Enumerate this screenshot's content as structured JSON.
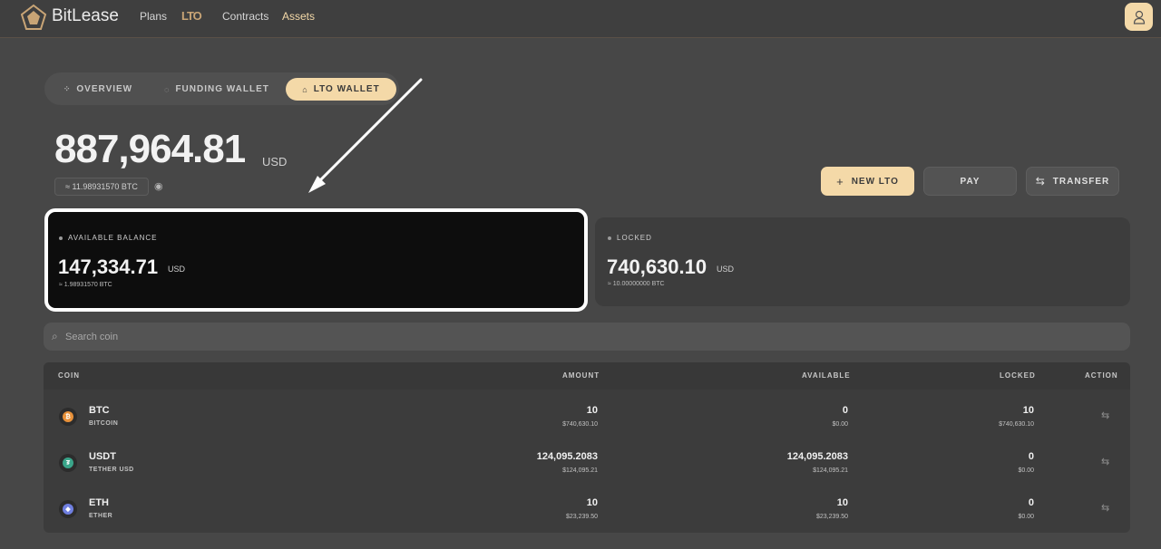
{
  "header": {
    "brand": "BitLease",
    "nav": {
      "plans": "Plans",
      "lto": "LTO",
      "contracts": "Contracts",
      "assets": "Assets"
    }
  },
  "tabs": [
    {
      "label": "OVERVIEW",
      "icon": "grid-icon"
    },
    {
      "label": "FUNDING WALLET",
      "icon": "wallet-icon"
    },
    {
      "label": "LTO WALLET",
      "icon": "bank-icon",
      "active": true
    }
  ],
  "summary": {
    "total": "887,964.81",
    "currency": "USD",
    "btc_equivalent": "≈ 11.98931570 BTC"
  },
  "actions": {
    "new_lto": "NEW LTO",
    "pay": "PAY",
    "transfer": "TRANSFER"
  },
  "cards": {
    "available": {
      "label": "AVAILABLE BALANCE",
      "value": "147,334.71",
      "currency": "USD",
      "btc": "≈ 1.98931570 BTC"
    },
    "locked": {
      "label": "LOCKED",
      "value": "740,630.10",
      "currency": "USD",
      "btc": "≈ 10.00000000 BTC"
    }
  },
  "search": {
    "placeholder": "Search coin"
  },
  "table": {
    "headers": {
      "coin": "COIN",
      "amount": "AMOUNT",
      "available": "AVAILABLE",
      "locked": "LOCKED",
      "action": "ACTION"
    },
    "rows": [
      {
        "symbol": "BTC",
        "name": "BITCOIN",
        "icon_color": "#e8913a",
        "amount": "10",
        "amount_usd": "$740,630.10",
        "available": "0",
        "available_usd": "$0.00",
        "locked": "10",
        "locked_usd": "$740,630.10"
      },
      {
        "symbol": "USDT",
        "name": "TETHER USD",
        "icon_color": "#3aa58a",
        "amount": "124,095.2083",
        "amount_usd": "$124,095.21",
        "available": "124,095.2083",
        "available_usd": "$124,095.21",
        "locked": "0",
        "locked_usd": "$0.00"
      },
      {
        "symbol": "ETH",
        "name": "ETHER",
        "icon_color": "#6f7fe0",
        "amount": "10",
        "amount_usd": "$23,239.50",
        "available": "10",
        "available_usd": "$23,239.50",
        "locked": "0",
        "locked_usd": "$0.00"
      }
    ]
  },
  "colors": {
    "accent": "#f4d9a8",
    "background": "#474747",
    "highlight_border": "#ffffff"
  }
}
